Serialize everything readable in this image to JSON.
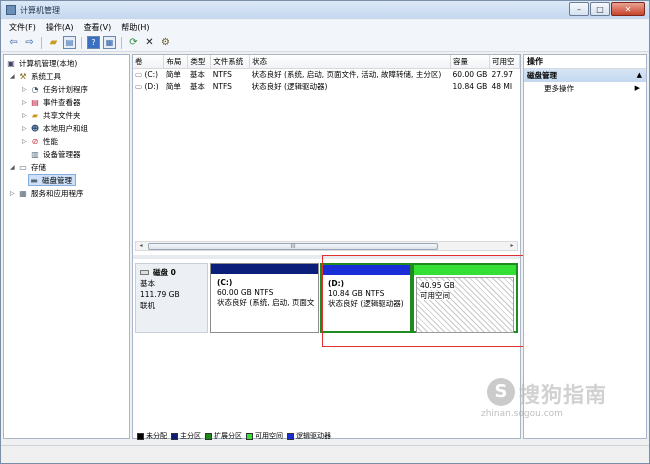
{
  "window": {
    "title": "计算机管理"
  },
  "menu": [
    "文件(F)",
    "操作(A)",
    "查看(V)",
    "帮助(H)"
  ],
  "toolbar_icons": [
    "back-arrow-icon",
    "forward-arrow-icon",
    "folder-up-icon",
    "show-hide-tree-icon",
    "help-icon",
    "properties-icon",
    "refresh-icon",
    "delete-icon",
    "disk-settings-icon"
  ],
  "tree": [
    {
      "label": "计算机管理(本地)",
      "icon": "computer-icon"
    },
    {
      "label": "系统工具",
      "icon": "tools-icon"
    },
    {
      "label": "任务计划程序",
      "icon": "clock-icon"
    },
    {
      "label": "事件查看器",
      "icon": "event-viewer-icon"
    },
    {
      "label": "共享文件夹",
      "icon": "shared-folder-icon"
    },
    {
      "label": "本地用户和组",
      "icon": "users-icon"
    },
    {
      "label": "性能",
      "icon": "performance-icon"
    },
    {
      "label": "设备管理器",
      "icon": "device-manager-icon"
    },
    {
      "label": "存储",
      "icon": "storage-icon"
    },
    {
      "label": "磁盘管理",
      "icon": "disk-management-icon"
    },
    {
      "label": "服务和应用程序",
      "icon": "services-icon"
    }
  ],
  "volume_table": {
    "columns": [
      "卷",
      "布局",
      "类型",
      "文件系统",
      "状态",
      "容量",
      "可用空"
    ],
    "rows": [
      [
        "(C:)",
        "简单",
        "基本",
        "NTFS",
        "状态良好 (系统, 启动, 页面文件, 活动, 故障转储, 主分区)",
        "60.00 GB",
        "27.97"
      ],
      [
        "(D:)",
        "简单",
        "基本",
        "NTFS",
        "状态良好 (逻辑驱动器)",
        "10.84 GB",
        "48 MI"
      ]
    ],
    "scroll_label": "III"
  },
  "disk": {
    "name": "磁盘 0",
    "type": "基本",
    "size": "111.79 GB",
    "status": "联机",
    "partitions": [
      {
        "label": "(C:)",
        "size": "60.00 GB NTFS",
        "status": "状态良好 (系统, 启动, 页面文",
        "color": "#0b1f7a"
      },
      {
        "label": "(D:)",
        "size": "10.84 GB NTFS",
        "status": "状态良好 (逻辑驱动器)",
        "color": "#1a2ed8"
      },
      {
        "size": "40.95 GB",
        "status": "可用空间",
        "color": "#33e033"
      }
    ]
  },
  "legend": [
    {
      "label": "未分配",
      "color": "#000000"
    },
    {
      "label": "主分区",
      "color": "#0b1f7a"
    },
    {
      "label": "扩展分区",
      "color": "#1a8a1a"
    },
    {
      "label": "可用空间",
      "color": "#33e033"
    },
    {
      "label": "逻辑驱动器",
      "color": "#1a2ed8"
    }
  ],
  "actions": {
    "header": "操作",
    "section": "磁盘管理",
    "items": [
      "更多操作"
    ]
  },
  "watermark": {
    "text": "搜狗指南",
    "url": "zhinan.sogou.com",
    "logo": "S"
  }
}
